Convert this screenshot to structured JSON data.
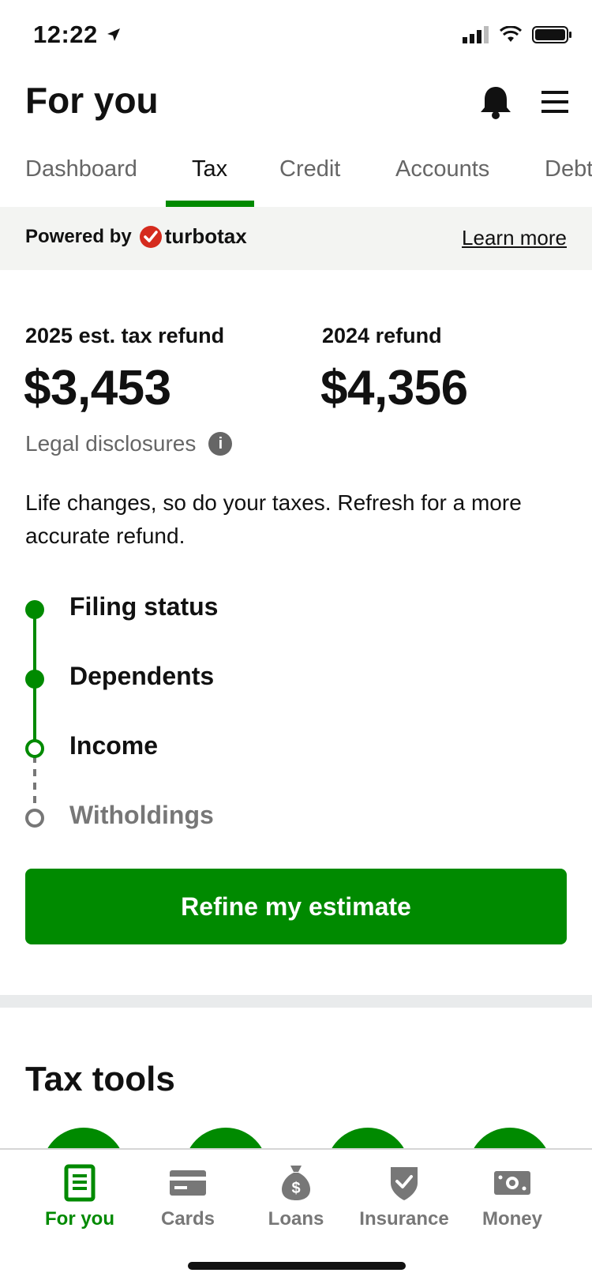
{
  "status": {
    "time": "12:22"
  },
  "header": {
    "title": "For you"
  },
  "tabs": [
    {
      "label": "Dashboard",
      "active": false
    },
    {
      "label": "Tax",
      "active": true
    },
    {
      "label": "Credit",
      "active": false
    },
    {
      "label": "Accounts",
      "active": false
    },
    {
      "label": "Debt",
      "active": false
    }
  ],
  "powered": {
    "prefix": "Powered by",
    "brand": "turbotax",
    "link": "Learn more"
  },
  "refunds": {
    "estimate": {
      "label": "2025 est. tax refund",
      "amount": "$3,453"
    },
    "previous": {
      "label": "2024 refund",
      "amount": "$4,356"
    }
  },
  "legal": {
    "label": "Legal disclosures",
    "icon": "info-icon"
  },
  "description": "Life changes, so do your taxes. Refresh for a more accurate refund.",
  "steps": [
    {
      "label": "Filing status",
      "state": "complete"
    },
    {
      "label": "Dependents",
      "state": "complete"
    },
    {
      "label": "Income",
      "state": "current"
    },
    {
      "label": "Witholdings",
      "state": "pending"
    }
  ],
  "cta": {
    "label": "Refine my estimate"
  },
  "tools": {
    "title": "Tax tools"
  },
  "bottom_nav": [
    {
      "label": "For you",
      "icon": "document-icon",
      "active": true
    },
    {
      "label": "Cards",
      "icon": "card-icon",
      "active": false
    },
    {
      "label": "Loans",
      "icon": "money-bag-icon",
      "active": false
    },
    {
      "label": "Insurance",
      "icon": "shield-icon",
      "active": false
    },
    {
      "label": "Money",
      "icon": "cash-icon",
      "active": false
    }
  ],
  "colors": {
    "brand_green": "#008a00",
    "muted": "#777777",
    "band": "#f3f4f2"
  }
}
